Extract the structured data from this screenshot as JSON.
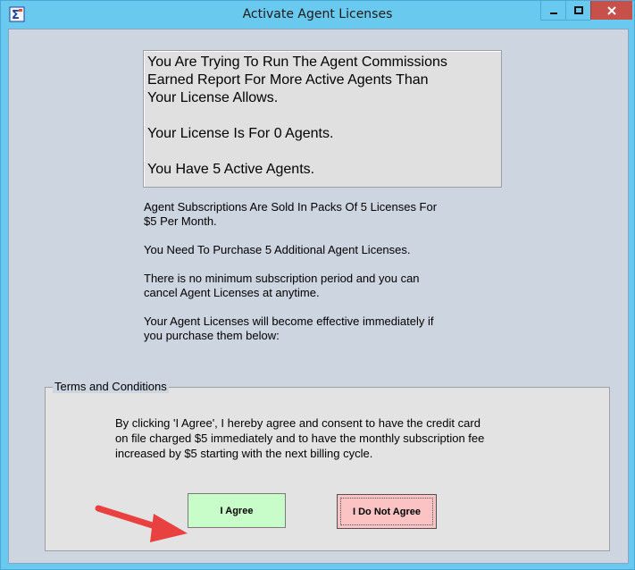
{
  "window": {
    "title": "Activate Agent Licenses",
    "controls": [
      "minimize",
      "maximize",
      "close"
    ]
  },
  "message_box": {
    "line1": "You Are Trying To Run The Agent Commissions",
    "line2": "Earned Report For More Active Agents Than",
    "line3": "Your License Allows.",
    "license_line": "Your License Is For 0 Agents.",
    "active_line": "You Have 5 Active Agents."
  },
  "info": {
    "pack_line1": "Agent Subscriptions Are Sold In Packs Of 5 Licenses For",
    "pack_line2": "$5 Per Month.",
    "need_line": "You Need To Purchase 5 Additional Agent Licenses.",
    "cancel_line1": "There is no minimum subscription period and you can",
    "cancel_line2": "cancel Agent Licenses at anytime.",
    "effective_line1": "Your Agent Licenses will become effective immediately if",
    "effective_line2": "you purchase them below:"
  },
  "terms": {
    "legend": "Terms and Conditions",
    "line1": "By clicking 'I Agree', I hereby agree and consent to have the credit card",
    "line2": "on file charged $5 immediately and to have the monthly subscription fee",
    "line3": "increased by $5 starting with the next billing cycle.",
    "agree_label": "I Agree",
    "disagree_label": "I Do Not Agree"
  },
  "colors": {
    "titlebar": "#69c9ef",
    "client": "#cdd5e1",
    "agree_button": "#c8fcc8",
    "disagree_button": "#fbc3c3",
    "close_button": "#c7504b",
    "annotation_arrow": "#e8413f"
  }
}
